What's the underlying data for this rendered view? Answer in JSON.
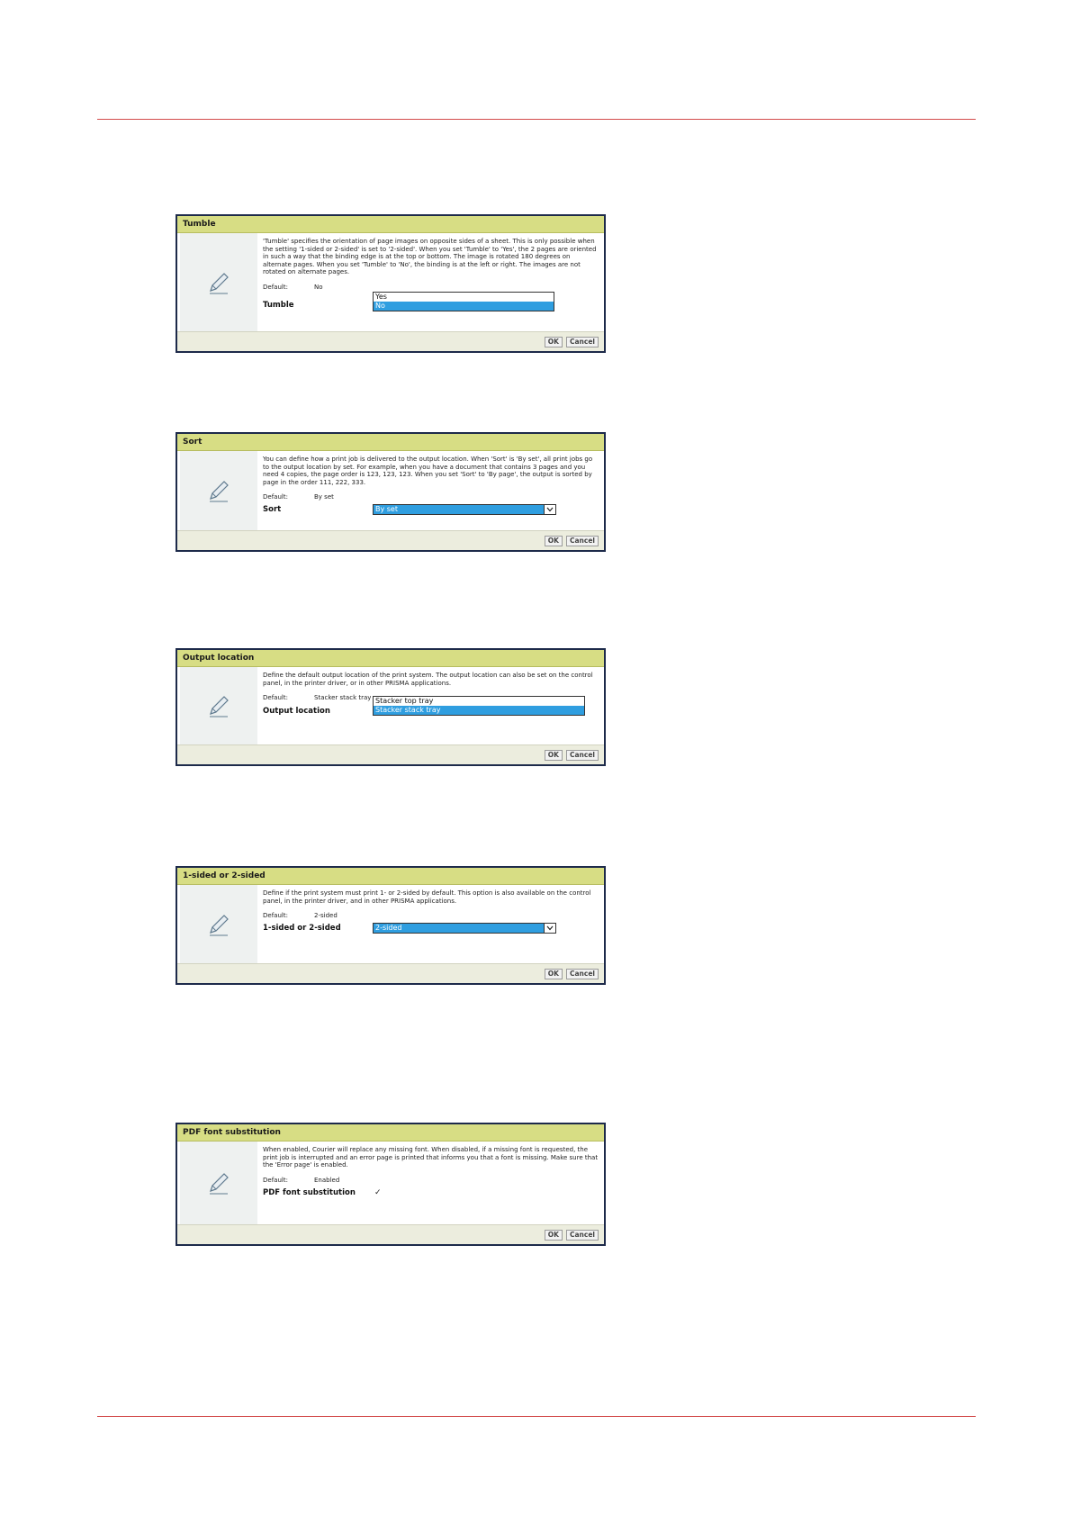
{
  "dialogs": [
    {
      "title": "Tumble",
      "description": "'Tumble' specifies the orientation of page images on opposite sides of a sheet. This is only possible when the setting '1-sided or 2-sided' is set to '2-sided'. When you set 'Tumble' to 'Yes', the 2 pages are oriented in such a way that the binding edge is at the top or bottom. The image is rotated 180 degrees on alternate pages. When you set 'Tumble' to 'No', the binding is at the left or right. The images are not rotated on alternate pages.",
      "default_label": "Default:",
      "default_value": "No",
      "setting_label": "Tumble",
      "options": [
        "Yes",
        "No"
      ],
      "selected": "No",
      "ok": "OK",
      "cancel": "Cancel"
    },
    {
      "title": "Sort",
      "description": "You can define how a print job is delivered to the output location. When 'Sort' is 'By set', all print jobs go to the output location by set. For example, when you have a document that contains 3 pages and you need 4 copies, the page order is 123, 123, 123. When you set 'Sort' to 'By page', the output is sorted by page in the order 111, 222, 333.",
      "default_label": "Default:",
      "default_value": "By set",
      "setting_label": "Sort",
      "selected": "By set",
      "ok": "OK",
      "cancel": "Cancel"
    },
    {
      "title": "Output location",
      "description": "Define the default output location of the print system. The output location can also be set on the control panel, in the printer driver, or in other PRISMA applications.",
      "default_label": "Default:",
      "default_value": "Stacker stack tray",
      "setting_label": "Output location",
      "options": [
        "Stacker top tray",
        "Stacker stack tray"
      ],
      "selected": "Stacker stack tray",
      "ok": "OK",
      "cancel": "Cancel"
    },
    {
      "title": "1-sided or 2-sided",
      "description": "Define if the print system must print 1- or 2-sided by default. This option is also available on the control panel, in the printer driver, and in other PRISMA applications.",
      "default_label": "Default:",
      "default_value": "2-sided",
      "setting_label": "1-sided or 2-sided",
      "selected": "2-sided",
      "ok": "OK",
      "cancel": "Cancel"
    },
    {
      "title": "PDF font substitution",
      "description": "When enabled, Courier will replace any missing font. When disabled, if a missing font is requested, the print job is interrupted and an error page is printed that informs you that a font is missing. Make sure that the 'Error page' is enabled.",
      "default_label": "Default:",
      "default_value": "Enabled",
      "setting_label": "PDF font substitution",
      "checked_glyph": "✓",
      "ok": "OK",
      "cancel": "Cancel"
    }
  ]
}
